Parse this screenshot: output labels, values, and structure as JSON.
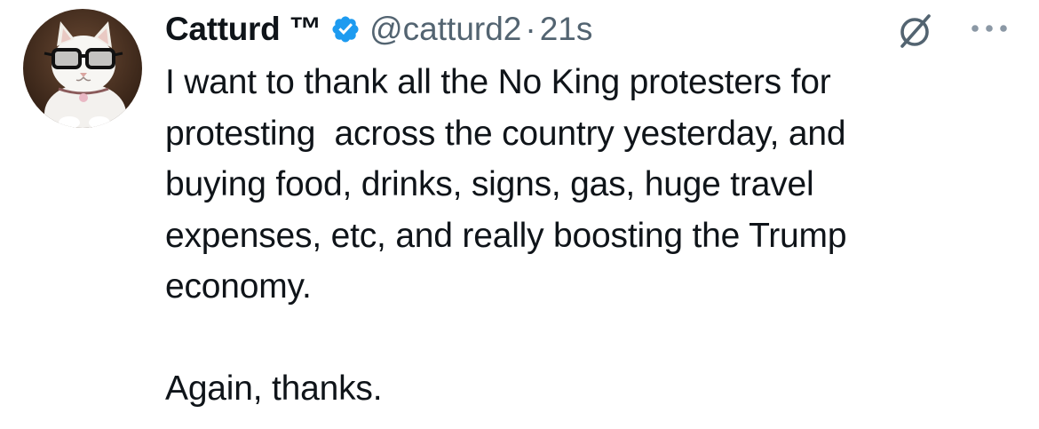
{
  "author": {
    "display_name": "Catturd ™",
    "handle": "@catturd2",
    "separator": "·",
    "timestamp": "21s",
    "verified": true,
    "verified_color": "#1d9bf0"
  },
  "tweet": {
    "text": "I want to thank all the No King protesters for\nprotesting  across the country yesterday, and\nbuying food, drinks, signs, gas, huge travel\nexpenses, etc, and really boosting the Trump\neconomy.\n\nAgain, thanks."
  },
  "icons": {
    "avatar": "cat-with-glasses-avatar",
    "verified": "verified-badge-icon",
    "grok": "grok-icon",
    "more": "more-options-icon"
  },
  "colors": {
    "text": "#0f1419",
    "secondary": "#536471",
    "accent": "#1d9bf0"
  }
}
